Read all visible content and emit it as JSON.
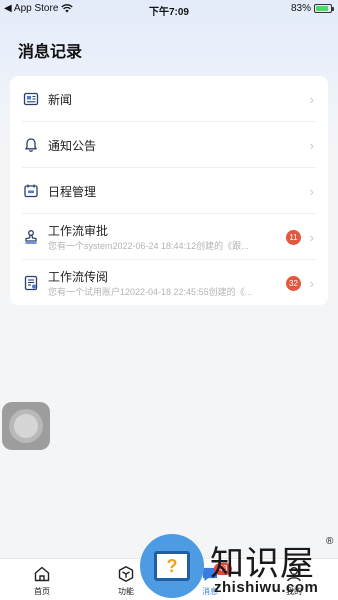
{
  "status_bar": {
    "back_app": "◀ App Store",
    "time": "下午7:09",
    "battery": "83%",
    "battery_level": 0.83
  },
  "page": {
    "title": "消息记录"
  },
  "rows": [
    {
      "name": "news",
      "label": "新闻",
      "icon": "news-icon"
    },
    {
      "name": "notice",
      "label": "通知公告",
      "icon": "bell-icon"
    },
    {
      "name": "schedule",
      "label": "日程管理",
      "icon": "calendar-icon"
    },
    {
      "name": "approval",
      "label": "工作流审批",
      "subtitle": "您有一个system2022-06-24 18:44:12创建的《跟...",
      "badge": "11",
      "icon": "stamp-icon"
    },
    {
      "name": "circulation",
      "label": "工作流传阅",
      "subtitle": "您有一个试用账户12022-04-18 22:45:55创建的《...",
      "badge": "32",
      "icon": "document-icon"
    }
  ],
  "tabbar": {
    "tabs": [
      {
        "label": "首页",
        "icon": "home-icon"
      },
      {
        "label": "功能",
        "icon": "cube-icon"
      },
      {
        "label": "消息",
        "icon": "message-icon",
        "badge": "43",
        "active": true
      },
      {
        "label": "我的",
        "icon": "user-icon"
      }
    ]
  },
  "watermark": {
    "title": "知识屋",
    "reg": "®",
    "url": "zhishiwu.com",
    "glyph": "?"
  },
  "colors": {
    "accent": "#3a7be0",
    "badge": "#e2583e"
  }
}
